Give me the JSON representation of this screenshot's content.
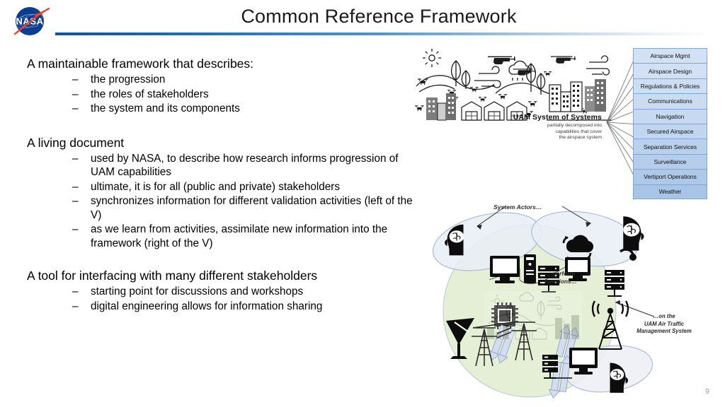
{
  "slide": {
    "title": "Common Reference Framework",
    "number": "9",
    "logo_alt": "NASA"
  },
  "body": {
    "sections": [
      {
        "heading": "A maintainable framework that describes:",
        "items": [
          "the progression",
          "the roles of stakeholders",
          "the system and its components"
        ]
      },
      {
        "heading": "A living document",
        "items": [
          "used by NASA, to describe how research informs progression of UAM capabilities",
          "ultimate, it is for all (public and private) stakeholders",
          "synchronizes information for different validation activities (left of the V)",
          "as we learn from activities, assimilate new information into the framework (right of the V)"
        ]
      },
      {
        "heading": "A tool for interfacing with many different stakeholders",
        "items": [
          "starting point for discussions and workshops",
          "digital engineering allows for information sharing"
        ]
      }
    ],
    "dash": "–"
  },
  "uam_diagram": {
    "title": "UAM System of Systems",
    "caption_lines": [
      "partially decomposed into",
      "capabilities that cover",
      "the airspace system"
    ]
  },
  "capabilities": [
    "Airspace Mgmt",
    "Airspace Design",
    "Regulations & Policies",
    "Communications",
    "Navigation",
    "Secured Airspace",
    "Separation Services",
    "Surveillance",
    "Vertiport Operations",
    "Weather"
  ],
  "actors_diagram": {
    "annotation_actors": "System Actors…",
    "annotation_perform_line1": "…perform",
    "annotation_perform_line2": "functions…",
    "annotation_atm_line1": "…on the",
    "annotation_atm_line2": "UAM Air Traffic",
    "annotation_atm_line3": "Management System"
  },
  "colors": {
    "accent_blue": "#10529e",
    "box_fill_light": "#cfdff2",
    "box_fill_dark": "#a8c6e8",
    "box_border": "#7fa6d4",
    "ellipse_blue": "#e7ecf5",
    "circle_green": "#e3eed3",
    "nasa_blue": "#0b3d91",
    "nasa_red": "#fc3d21"
  }
}
